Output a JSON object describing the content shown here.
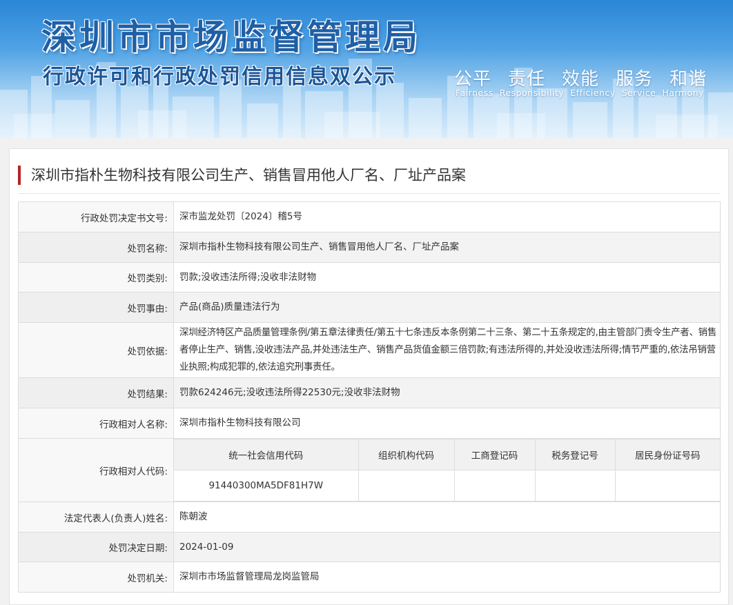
{
  "banner": {
    "title": "深圳市市场监督管理局",
    "subtitle": "行政许可和行政处罚信用信息双公示",
    "slogans_cn": [
      "公平",
      "责任",
      "效能",
      "服务",
      "和谐"
    ],
    "slogans_en": [
      "Fairness",
      "Responsibility",
      "Efficiency",
      "Service",
      "Harmony"
    ]
  },
  "case": {
    "title": "深圳市指朴生物科技有限公司生产、销售冒用他人厂名、厂址产品案"
  },
  "fields": {
    "doc_no": {
      "label": "行政处罚决定书文号:",
      "value": "深市监龙处罚〔2024〕稽5号"
    },
    "penalty_name": {
      "label": "处罚名称:",
      "value": "深圳市指朴生物科技有限公司生产、销售冒用他人厂名、厂址产品案"
    },
    "penalty_type": {
      "label": "处罚类别:",
      "value": "罚款;没收违法所得;没收非法财物"
    },
    "penalty_reason": {
      "label": "处罚事由:",
      "value": "产品(商品)质量违法行为"
    },
    "penalty_basis": {
      "label": "处罚依据:",
      "value": "深圳经济特区产品质量管理条例/第五章法律责任/第五十七条违反本条例第二十三条、第二十五条规定的,由主管部门责令生产者、销售者停止生产、销售,没收违法产品,并处违法生产、销售产品货值金额三倍罚款;有违法所得的,并处没收违法所得;情节严重的,依法吊销营业执照;构成犯罪的,依法追究刑事责任。"
    },
    "penalty_result": {
      "label": "处罚结果:",
      "value": "罚款624246元;没收违法所得22530元;没收非法财物"
    },
    "party_name": {
      "label": "行政相对人名称:",
      "value": "深圳市指朴生物科技有限公司"
    },
    "party_code": {
      "label": "行政相对人代码:",
      "headers": [
        "统一社会信用代码",
        "组织机构代码",
        "工商登记码",
        "税务登记号",
        "居民身份证号码"
      ],
      "values": [
        "91440300MA5DF81H7W",
        "",
        "",
        "",
        ""
      ]
    },
    "legal_rep": {
      "label": "法定代表人(负责人)姓名:",
      "value": "陈朝波"
    },
    "decision_date": {
      "label": "处罚决定日期:",
      "value": "2024-01-09"
    },
    "authority": {
      "label": "处罚机关:",
      "value": "深圳市市场监督管理局龙岗监管局"
    }
  }
}
